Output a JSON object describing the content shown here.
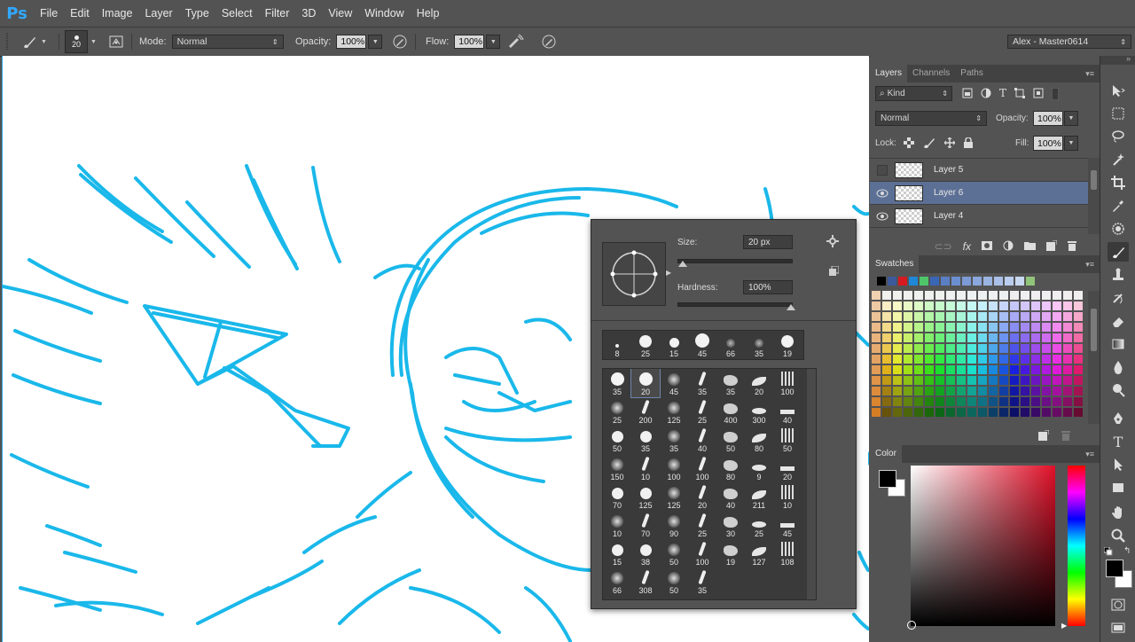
{
  "app_logo": "Ps",
  "menu": [
    "File",
    "Edit",
    "Image",
    "Layer",
    "Type",
    "Select",
    "Filter",
    "3D",
    "View",
    "Window",
    "Help"
  ],
  "options": {
    "brush_size": "20",
    "mode_label": "Mode:",
    "mode_value": "Normal",
    "opacity_label": "Opacity:",
    "opacity_value": "100%",
    "flow_label": "Flow:",
    "flow_value": "100%",
    "workspace": "Alex - Master0614"
  },
  "layers_panel": {
    "tabs": [
      "Layers",
      "Channels",
      "Paths"
    ],
    "filter_kind": "Kind",
    "blend_mode": "Normal",
    "opacity_label": "Opacity:",
    "opacity_value": "100%",
    "lock_label": "Lock:",
    "fill_label": "Fill:",
    "fill_value": "100%",
    "layers": [
      {
        "name": "Layer 5",
        "visible": false,
        "selected": false
      },
      {
        "name": "Layer 6",
        "visible": true,
        "selected": true
      },
      {
        "name": "Layer 4",
        "visible": true,
        "selected": false
      }
    ]
  },
  "swatches_panel": {
    "title": "Swatches"
  },
  "color_panel": {
    "title": "Color",
    "foreground": "#000000",
    "background": "#ffffff"
  },
  "brush_picker": {
    "size_label": "Size:",
    "size_value": "20 px",
    "size_fraction": 0.05,
    "hardness_label": "Hardness:",
    "hardness_value": "100%",
    "hardness_fraction": 1.0,
    "recent": [
      "8",
      "25",
      "15",
      "45",
      "66",
      "35",
      "19"
    ],
    "presets": [
      [
        "35",
        "20",
        "45",
        "35",
        "35",
        "20",
        "100"
      ],
      [
        "25",
        "200",
        "125",
        "25",
        "400",
        "300",
        "40"
      ],
      [
        "50",
        "35",
        "35",
        "40",
        "50",
        "80",
        "50"
      ],
      [
        "150",
        "10",
        "100",
        "100",
        "80",
        "9",
        "20"
      ],
      [
        "70",
        "125",
        "125",
        "20",
        "40",
        "211",
        "10"
      ],
      [
        "10",
        "70",
        "90",
        "25",
        "30",
        "25",
        "45"
      ],
      [
        "15",
        "38",
        "50",
        "100",
        "19",
        "127",
        "108"
      ],
      [
        "66",
        "308",
        "50",
        "35"
      ]
    ],
    "selected_preset": "20"
  },
  "colors": {
    "sketch_blue": "#1ab8ea",
    "selection_blue": "#5c7096",
    "accent": "#31a8ff"
  }
}
